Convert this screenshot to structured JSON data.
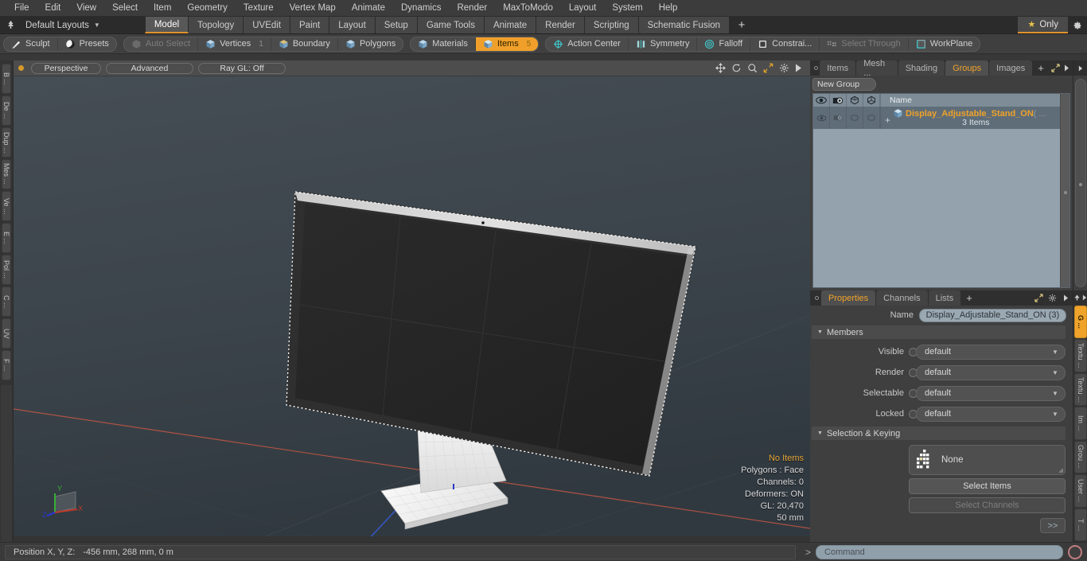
{
  "menubar": {
    "items": [
      {
        "label": "File"
      },
      {
        "label": "Edit"
      },
      {
        "label": "View"
      },
      {
        "label": "Select"
      },
      {
        "label": "Item"
      },
      {
        "label": "Geometry"
      },
      {
        "label": "Texture"
      },
      {
        "label": "Vertex Map"
      },
      {
        "label": "Animate"
      },
      {
        "label": "Dynamics"
      },
      {
        "label": "Render"
      },
      {
        "label": "MaxToModo"
      },
      {
        "label": "Layout"
      },
      {
        "label": "System"
      },
      {
        "label": "Help"
      }
    ]
  },
  "layoutbar": {
    "home_icon": "home-tree-icon",
    "layouts_label": "Default Layouts",
    "tabs": [
      {
        "label": "Model",
        "active": true
      },
      {
        "label": "Topology",
        "active": false
      },
      {
        "label": "UVEdit",
        "active": false
      },
      {
        "label": "Paint",
        "active": false
      },
      {
        "label": "Layout",
        "active": false
      },
      {
        "label": "Setup",
        "active": false
      },
      {
        "label": "Game Tools",
        "active": false
      },
      {
        "label": "Animate",
        "active": false
      },
      {
        "label": "Render",
        "active": false
      },
      {
        "label": "Scripting",
        "active": false
      },
      {
        "label": "Schematic Fusion",
        "active": false
      }
    ],
    "add_tab_label": "+",
    "only_label": "Only",
    "only_icon": "star-icon",
    "gear_icon": "gear-icon"
  },
  "modebar": {
    "group1": [
      {
        "label": "Sculpt",
        "icon": "brush-icon",
        "state": "normal"
      },
      {
        "label": "Presets",
        "icon": "sphere-icon",
        "state": "normal"
      }
    ],
    "group2": [
      {
        "label": "Auto Select",
        "icon": "cube-grey-icon",
        "state": "dim",
        "count": ""
      },
      {
        "label": "Vertices",
        "icon": "cube-blue-icon",
        "state": "normal",
        "count": "1"
      },
      {
        "label": "Boundary",
        "icon": "cube-edge-icon",
        "state": "normal",
        "count": ""
      },
      {
        "label": "Polygons",
        "icon": "cube-blue-icon",
        "state": "normal",
        "count": ""
      }
    ],
    "group3": [
      {
        "label": "Materials",
        "icon": "cube-blue-icon",
        "state": "normal",
        "count": ""
      },
      {
        "label": "Items",
        "icon": "cube-orange-icon",
        "state": "selected",
        "count": "5"
      }
    ],
    "group4": [
      {
        "label": "Action Center",
        "icon": "target-icon",
        "state": "normal"
      },
      {
        "label": "Symmetry",
        "icon": "symmetry-icon",
        "state": "normal"
      },
      {
        "label": "Falloff",
        "icon": "falloff-icon",
        "state": "normal"
      },
      {
        "label": "Constrai...",
        "icon": "constraint-icon",
        "state": "normal"
      },
      {
        "label": "Select Through",
        "icon": "select-through-icon",
        "state": "dim"
      },
      {
        "label": "WorkPlane",
        "icon": "workplane-icon",
        "state": "normal"
      }
    ]
  },
  "left_strip": {
    "tabs": [
      {
        "label": "B ..."
      },
      {
        "label": "De ..."
      },
      {
        "label": "Dup ..."
      },
      {
        "label": "Mes ..."
      },
      {
        "label": "Ve ..."
      },
      {
        "label": "E ..."
      },
      {
        "label": "Pol ..."
      },
      {
        "label": "C ..."
      },
      {
        "label": "UV"
      },
      {
        "label": "F ..."
      }
    ]
  },
  "viewport": {
    "header": {
      "projection": "Perspective",
      "shading": "Advanced",
      "raygl": "Ray GL: Off",
      "icons": [
        "pan-icon",
        "rotate-icon",
        "zoom-icon",
        "fit-icon",
        "gear-icon",
        "play-icon"
      ]
    },
    "hud": {
      "selection": "No Items",
      "polygons": "Polygons : Face",
      "channels": "Channels: 0",
      "deformers": "Deformers: ON",
      "gl": "GL: 20,470",
      "scale": "50 mm"
    },
    "gizmo": {
      "x_label": "X",
      "y_label": "Y",
      "z_label": "Z"
    },
    "colors": {
      "background_top": "#414a50",
      "background_bottom": "#333b41",
      "grid_x_axis": "#c0564a",
      "grid_z_axis": "#3a5ccc",
      "model_screen": "#242424",
      "model_bezel": "#2b2b2b",
      "model_stand": "#e9e9e9"
    }
  },
  "groups_panel": {
    "tabs": [
      {
        "label": "Items",
        "active": false
      },
      {
        "label": "Mesh ...",
        "active": false
      },
      {
        "label": "Shading",
        "active": false
      },
      {
        "label": "Groups",
        "active": true
      },
      {
        "label": "Images",
        "active": false
      }
    ],
    "add_tab_label": "+",
    "new_group_label": "New Group",
    "columns": [
      {
        "icon": "eye-icon",
        "name": "visible-column"
      },
      {
        "icon": "render-camera-icon",
        "name": "render-column"
      },
      {
        "icon": "cube-outline-icon",
        "name": "selectable-column"
      },
      {
        "icon": "cube-lock-icon",
        "name": "locked-column"
      }
    ],
    "name_header": "Name",
    "rows": [
      {
        "expander": "+",
        "icon": "group-cube-icon",
        "title": "Display_Adjustable_Stand_ON",
        "suffix": "( ...",
        "subtitle": "3 Items",
        "selected": true
      }
    ]
  },
  "properties_panel": {
    "tabs": [
      {
        "label": "Properties",
        "active": true
      },
      {
        "label": "Channels",
        "active": false
      },
      {
        "label": "Lists",
        "active": false
      }
    ],
    "add_tab_label": "+",
    "name_label": "Name",
    "name_value": "Display_Adjustable_Stand_ON (3)",
    "members_section": "Members",
    "member_rows": [
      {
        "label": "Visible",
        "value": "default"
      },
      {
        "label": "Render",
        "value": "default"
      },
      {
        "label": "Selectable",
        "value": "default"
      },
      {
        "label": "Locked",
        "value": "default"
      }
    ],
    "selection_section": "Selection & Keying",
    "none_value": "None",
    "none_icon": "item-matrix-icon",
    "select_items_label": "Select Items",
    "select_channels_label": "Select Channels",
    "expand_label": ">>"
  },
  "right_strip": {
    "tabs": [
      {
        "label": "G ...",
        "active": true
      },
      {
        "label": "Textu ...",
        "active": false
      },
      {
        "label": "Textu ...",
        "active": false
      },
      {
        "label": "Im ...",
        "active": false
      },
      {
        "label": "Grou ...",
        "active": false
      },
      {
        "label": "User ...",
        "active": false
      },
      {
        "label": "T ...",
        "active": false
      }
    ]
  },
  "statusbar": {
    "position_label": "Position X, Y, Z:",
    "position_value": "-456 mm, 268 mm, 0 m",
    "command_caret": ">",
    "command_placeholder": "Command",
    "record_icon": "record-icon"
  }
}
